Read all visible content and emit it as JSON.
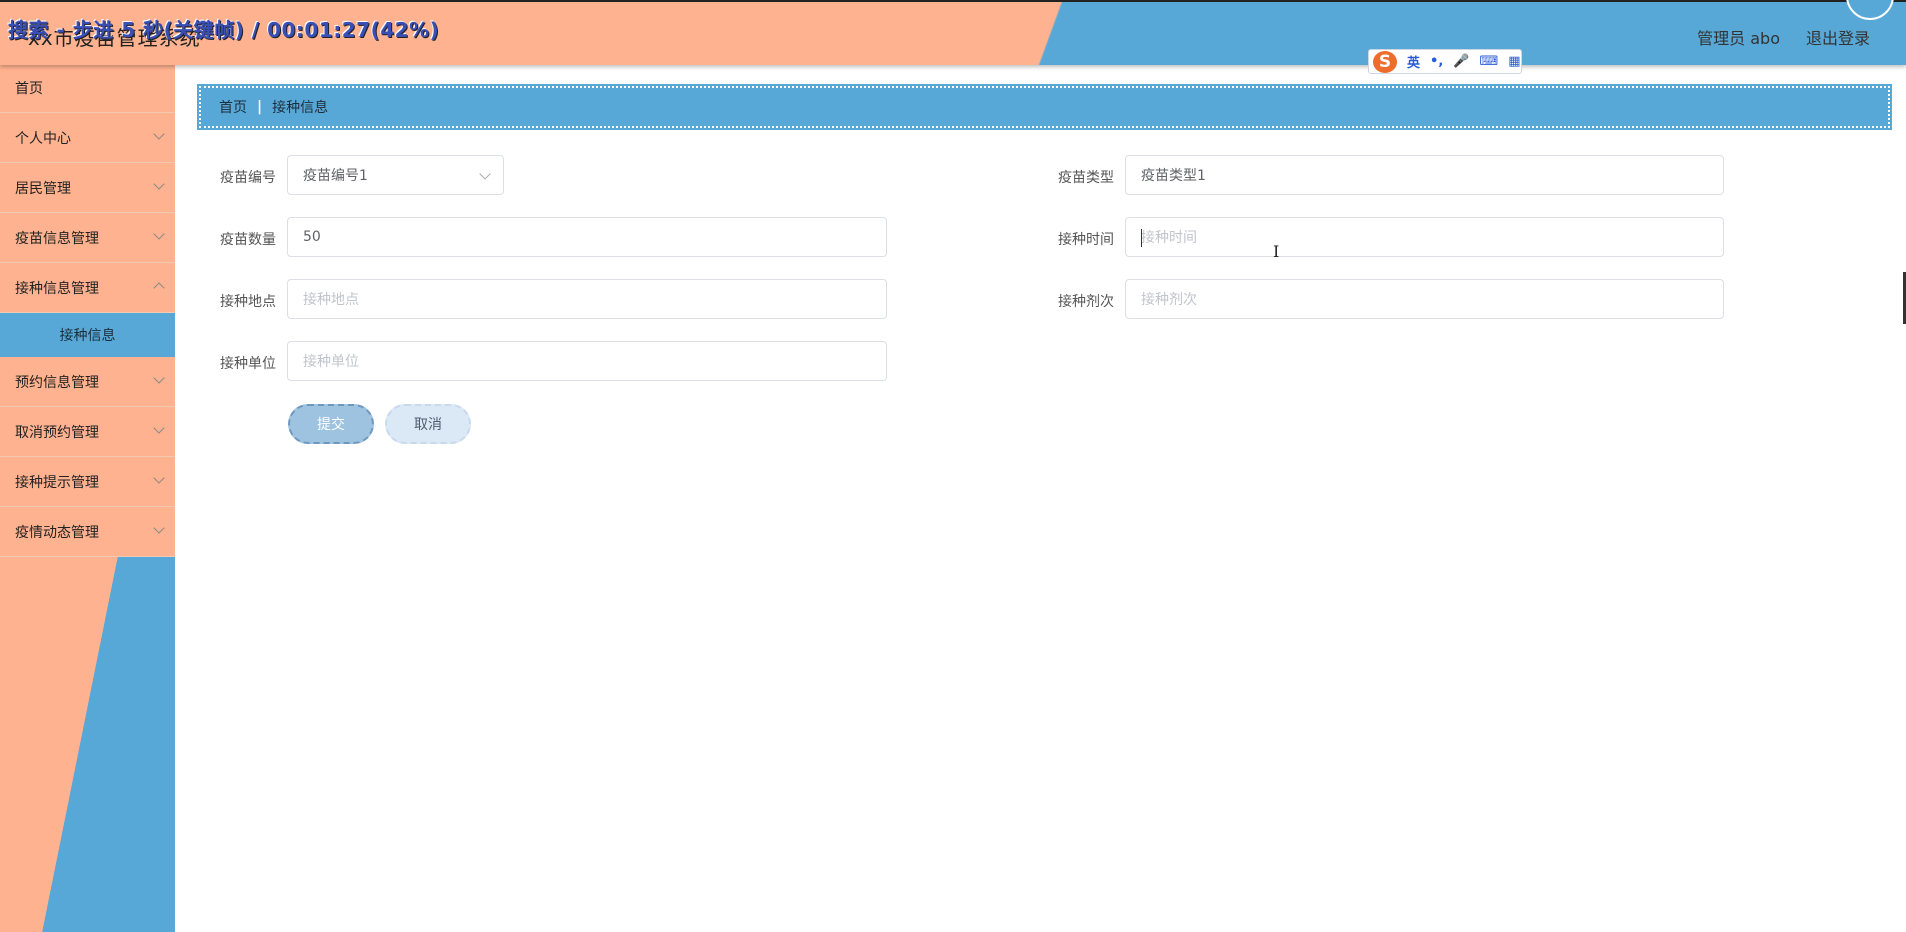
{
  "header": {
    "app_title": "xx市疫苗管理系统",
    "overlay_caption": "搜索 - 步进 5 秒(关键帧) / 00:01:27(42%)",
    "user_label": "管理员 abo",
    "logout_label": "退出登录"
  },
  "ime": {
    "logo": "S",
    "lang": "英",
    "punct": "•,",
    "mic_icon": "🎤",
    "keyboard_icon": "⌨",
    "apps_icon": "▦"
  },
  "sidebar": {
    "items": [
      {
        "label": "首页"
      },
      {
        "label": "个人中心"
      },
      {
        "label": "居民管理"
      },
      {
        "label": "疫苗信息管理"
      },
      {
        "label": "接种信息管理"
      },
      {
        "label": "预约信息管理"
      },
      {
        "label": "取消预约管理"
      },
      {
        "label": "接种提示管理"
      },
      {
        "label": "疫情动态管理"
      }
    ],
    "active_sub": "接种信息"
  },
  "breadcrumb": {
    "home": "首页",
    "separator": "|",
    "current": "接种信息"
  },
  "form": {
    "vaccine_no": {
      "label": "疫苗编号",
      "value": "疫苗编号1"
    },
    "vaccine_type": {
      "label": "疫苗类型",
      "value": "疫苗类型1"
    },
    "vaccine_qty": {
      "label": "疫苗数量",
      "value": "50"
    },
    "vacc_time": {
      "label": "接种时间",
      "placeholder": "接种时间"
    },
    "vacc_place": {
      "label": "接种地点",
      "placeholder": "接种地点"
    },
    "vacc_dose": {
      "label": "接种剂次",
      "placeholder": "接种剂次"
    },
    "vacc_unit": {
      "label": "接种单位",
      "placeholder": "接种单位"
    },
    "submit_label": "提交",
    "cancel_label": "取消"
  },
  "cursor_glyph": "I"
}
